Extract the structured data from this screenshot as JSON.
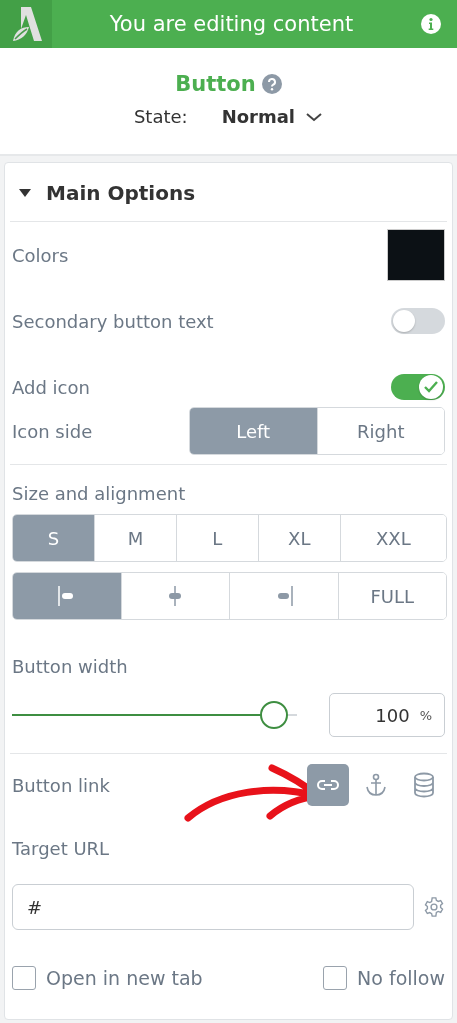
{
  "header": {
    "title": "You are editing content"
  },
  "element": {
    "title": "Button",
    "state_label": "State:",
    "state_value": "Normal"
  },
  "section": {
    "title": "Main Options",
    "expanded": true
  },
  "colors": {
    "label": "Colors",
    "color": "#0c1115"
  },
  "toggles": [
    {
      "label": "Secondary button text",
      "on": false
    },
    {
      "label": "Add icon",
      "on": true
    }
  ],
  "icon_side": {
    "label": "Icon side",
    "options": [
      {
        "label": "Left",
        "selected": true
      },
      {
        "label": "Right",
        "selected": false
      }
    ]
  },
  "size_alignment": {
    "label": "Size and alignment",
    "sizes": [
      {
        "label": "S",
        "selected": true
      },
      {
        "label": "M",
        "selected": false
      },
      {
        "label": "L",
        "selected": false
      },
      {
        "label": "XL",
        "selected": false
      },
      {
        "label": "XXL",
        "selected": false
      }
    ],
    "alignments": [
      {
        "kind": "left",
        "selected": true
      },
      {
        "kind": "center",
        "selected": false
      },
      {
        "kind": "right",
        "selected": false
      },
      {
        "kind": "text",
        "label": "FULL",
        "selected": false
      }
    ]
  },
  "button_width": {
    "label": "Button width",
    "level": 0.92,
    "value": "100",
    "unit": "%"
  },
  "button_link": {
    "label": "Button link",
    "types": [
      {
        "kind": "link",
        "selected": true
      },
      {
        "kind": "anchor",
        "selected": false
      },
      {
        "kind": "database",
        "selected": false
      }
    ]
  },
  "target_url": {
    "label": "Target URL",
    "value": "#"
  },
  "checkboxes": [
    {
      "label": "Open in new tab",
      "checked": false
    },
    {
      "label": "No follow",
      "checked": false
    }
  ]
}
